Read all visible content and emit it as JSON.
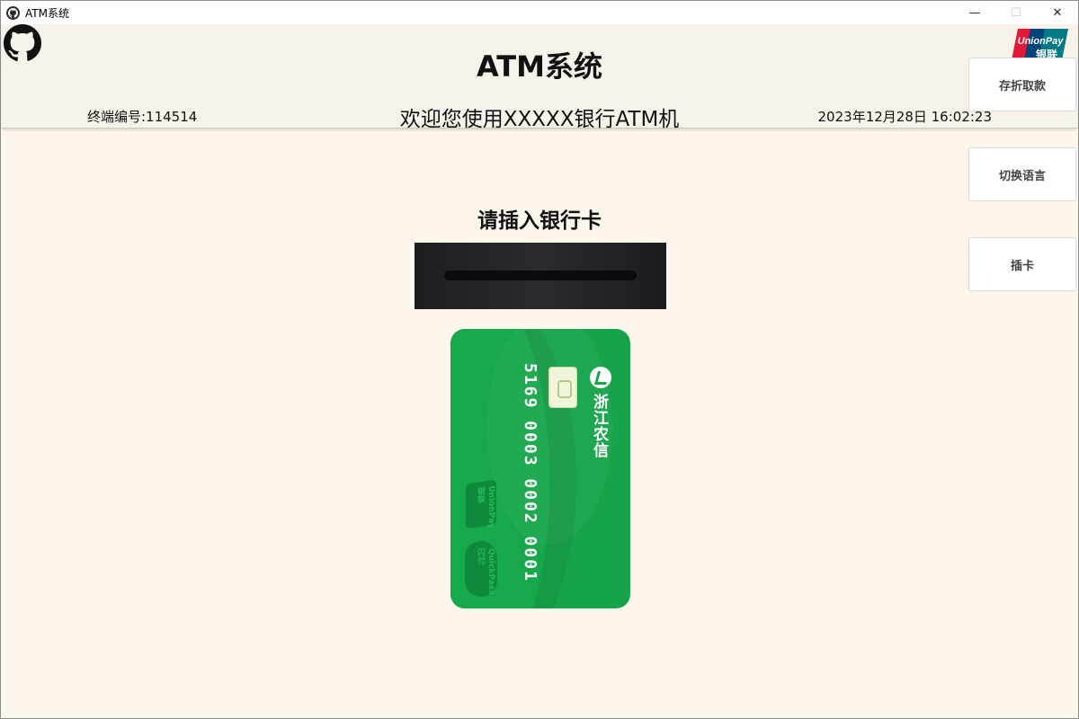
{
  "window": {
    "title": "ATM系统",
    "controls": {
      "minimize": "—",
      "maximize": "☐",
      "close": "✕"
    }
  },
  "header": {
    "title": "ATM系统",
    "terminal_id": "终端编号:114514",
    "welcome": "欢迎您使用XXXXX银行ATM机",
    "datetime": "2023年12月28日 16:02:23",
    "left_icon": "github-icon",
    "right_logo": {
      "name": "unionpay-logo",
      "line1": "UnionPay",
      "line2": "银联"
    }
  },
  "main": {
    "prompt": "请插入银行卡",
    "card": {
      "bank_name": "浙江农信",
      "number": "5169 0003 0002 0001",
      "brand_mark": "UnionPay 银联",
      "quickpass": "QuickPass 闪付",
      "color": "#16a34a"
    }
  },
  "side_buttons": {
    "deposit": "存折取款",
    "language": "切换语言",
    "insert": "插卡"
  }
}
